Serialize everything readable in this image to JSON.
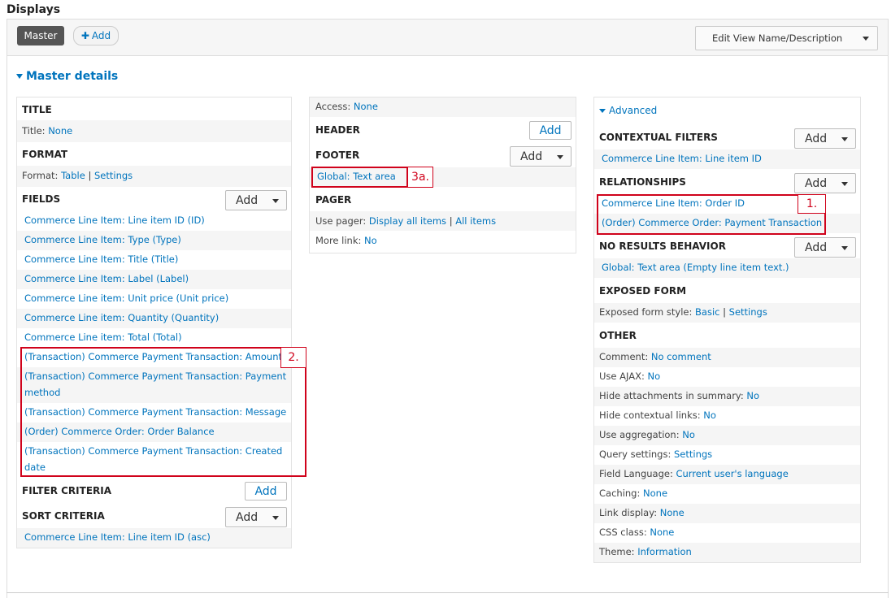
{
  "header": {
    "title": "Displays",
    "master_tab": "Master",
    "add_label": "Add",
    "edit_view": "Edit View Name/Description"
  },
  "master_details": "Master details",
  "col1": {
    "title_h": "TITLE",
    "title_label": "Title:",
    "title_value": "None",
    "format_h": "FORMAT",
    "format_label": "Format:",
    "format_value": "Table",
    "format_sep": "|",
    "format_settings": "Settings",
    "fields_h": "FIELDS",
    "fields_add": "Add",
    "fields": [
      "Commerce Line Item: Line item ID (ID)",
      "Commerce Line Item: Type (Type)",
      "Commerce Line Item: Title (Title)",
      "Commerce Line Item: Label (Label)",
      "Commerce Line item: Unit price (Unit price)",
      "Commerce Line item: Quantity (Quantity)",
      "Commerce Line item: Total (Total)",
      "(Transaction) Commerce Payment Transaction: Amount",
      "(Transaction) Commerce Payment Transaction: Payment",
      "method",
      "(Transaction) Commerce Payment Transaction: Message",
      "(Order) Commerce Order: Order Balance",
      "(Transaction) Commerce Payment Transaction: Created",
      "date"
    ],
    "filter_h": "FILTER CRITERIA",
    "filter_add": "Add",
    "sort_h": "SORT CRITERIA",
    "sort_add": "Add",
    "sort_item": "Commerce Line Item: Line item ID (asc)",
    "tag2": "2."
  },
  "col2": {
    "access_label": "Access:",
    "access_value": "None",
    "header_h": "HEADER",
    "header_add": "Add",
    "footer_h": "FOOTER",
    "footer_add": "Add",
    "footer_item": "Global: Text area",
    "tag3a": "3a.",
    "pager_h": "PAGER",
    "use_pager_label": "Use pager:",
    "use_pager_value": "Display all items",
    "use_pager_sep": "|",
    "use_pager_all": "All items",
    "more_link_label": "More link:",
    "more_link_value": "No"
  },
  "col3": {
    "advanced": "Advanced",
    "contextual_h": "CONTEXTUAL FILTERS",
    "contextual_add": "Add",
    "contextual_item": "Commerce Line Item: Line item ID",
    "relationships_h": "RELATIONSHIPS",
    "relationships_add": "Add",
    "rel_items": [
      "Commerce Line Item: Order ID",
      "(Order) Commerce Order: Payment Transaction"
    ],
    "tag1": "1.",
    "noresults_h": "NO RESULTS BEHAVIOR",
    "noresults_add": "Add",
    "noresults_item": "Global: Text area (Empty line item text.)",
    "exposed_h": "EXPOSED FORM",
    "exposed_label": "Exposed form style:",
    "exposed_value": "Basic",
    "exposed_sep": "|",
    "exposed_settings": "Settings",
    "other_h": "OTHER",
    "other": [
      {
        "label": "Comment:",
        "value": "No comment"
      },
      {
        "label": "Use AJAX:",
        "value": "No"
      },
      {
        "label": "Hide attachments in summary:",
        "value": "No"
      },
      {
        "label": "Hide contextual links:",
        "value": "No"
      },
      {
        "label": "Use aggregation:",
        "value": "No"
      },
      {
        "label": "Query settings:",
        "value": "Settings"
      },
      {
        "label": "Field Language:",
        "value": "Current user's language"
      },
      {
        "label": "Caching:",
        "value": "None"
      },
      {
        "label": "Link display:",
        "value": "None"
      },
      {
        "label": "CSS class:",
        "value": "None"
      },
      {
        "label": "Theme:",
        "value": "Information"
      }
    ]
  }
}
